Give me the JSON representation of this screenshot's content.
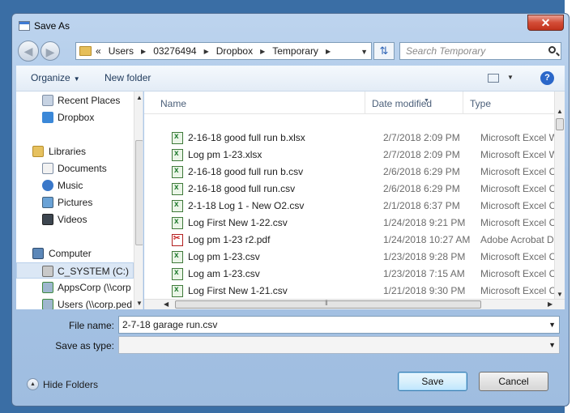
{
  "window": {
    "title": "Save As",
    "close_label": "✕"
  },
  "address": {
    "crumbs": [
      "«",
      "Users",
      "03276494",
      "Dropbox",
      "Temporary"
    ],
    "search_placeholder": "Search Temporary"
  },
  "toolbar": {
    "organize": "Organize",
    "new_folder": "New folder",
    "help": "?"
  },
  "nav": {
    "items": [
      {
        "label": "Recent Places",
        "icon": "recent-places-icon"
      },
      {
        "label": "Dropbox",
        "icon": "dropbox-icon"
      },
      {
        "label": "Libraries",
        "icon": "libraries-icon"
      },
      {
        "label": "Documents",
        "icon": "documents-icon"
      },
      {
        "label": "Music",
        "icon": "music-icon"
      },
      {
        "label": "Pictures",
        "icon": "pictures-icon"
      },
      {
        "label": "Videos",
        "icon": "videos-icon"
      },
      {
        "label": "Computer",
        "icon": "computer-icon"
      },
      {
        "label": "C_SYSTEM (C:)",
        "icon": "drive-icon"
      },
      {
        "label": "AppsCorp (\\\\corp",
        "icon": "network-drive-icon"
      },
      {
        "label": "Users (\\\\corp.ped",
        "icon": "network-drive-icon"
      }
    ]
  },
  "columns": {
    "name": "Name",
    "date": "Date modified",
    "type": "Type"
  },
  "files": [
    {
      "name": "2-16-18 good full run b.xlsx",
      "date": "2/7/2018 2:09 PM",
      "type": "Microsoft Excel W..."
    },
    {
      "name": "Log pm 1-23.xlsx",
      "date": "2/7/2018 2:09 PM",
      "type": "Microsoft Excel W..."
    },
    {
      "name": "2-16-18 good full run b.csv",
      "date": "2/6/2018 6:29 PM",
      "type": "Microsoft Excel C..."
    },
    {
      "name": "2-16-18 good full run.csv",
      "date": "2/6/2018 6:29 PM",
      "type": "Microsoft Excel C..."
    },
    {
      "name": "2-1-18 Log 1 - New O2.csv",
      "date": "2/1/2018 6:37 PM",
      "type": "Microsoft Excel C..."
    },
    {
      "name": "Log First New 1-22.csv",
      "date": "1/24/2018 9:21 PM",
      "type": "Microsoft Excel C..."
    },
    {
      "name": "Log pm 1-23 r2.pdf",
      "date": "1/24/2018 10:27 AM",
      "type": "Adobe Acrobat D..."
    },
    {
      "name": "Log pm 1-23.csv",
      "date": "1/23/2018 9:28 PM",
      "type": "Microsoft Excel C..."
    },
    {
      "name": "Log am 1-23.csv",
      "date": "1/23/2018 7:15 AM",
      "type": "Microsoft Excel C..."
    },
    {
      "name": "Log First New 1-21.csv",
      "date": "1/21/2018 9:30 PM",
      "type": "Microsoft Excel C..."
    }
  ],
  "form": {
    "file_name_label": "File name:",
    "file_name_value": "2-7-18 garage run.csv",
    "save_as_type_label": "Save as type:",
    "save_as_type_value": ""
  },
  "footer": {
    "hide_folders": "Hide Folders",
    "save": "Save",
    "cancel": "Cancel"
  }
}
